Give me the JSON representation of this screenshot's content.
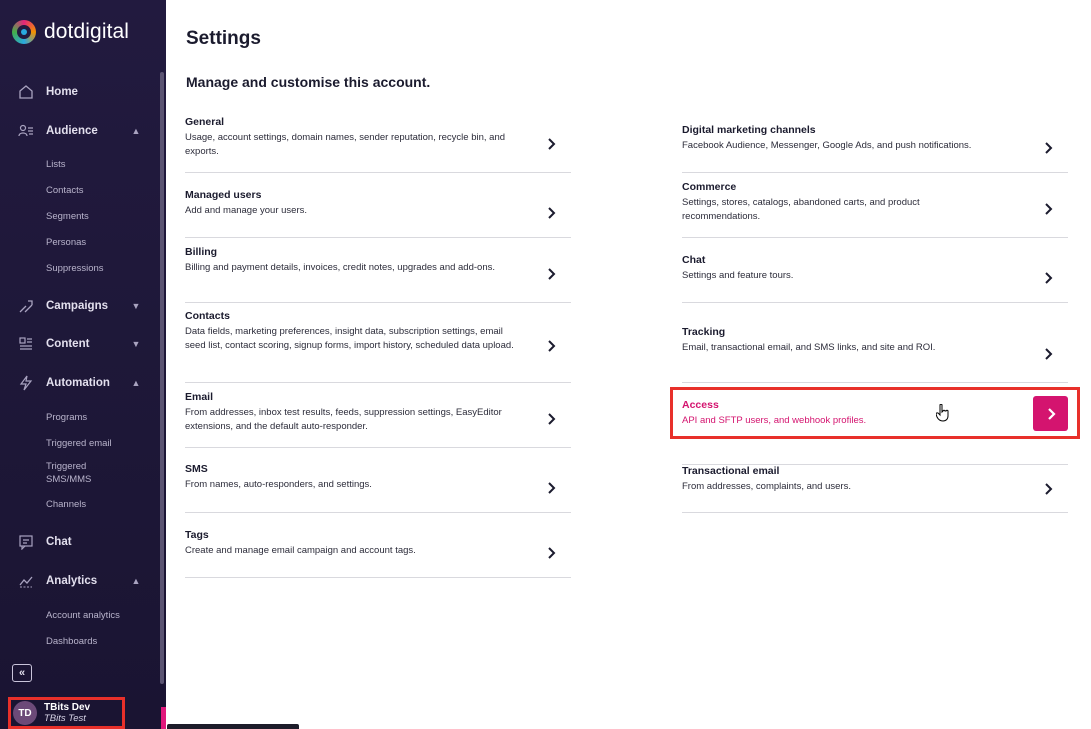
{
  "brand": {
    "name": "dotdigital"
  },
  "sidebar": {
    "nav": [
      {
        "label": "Home",
        "icon": "home-icon"
      },
      {
        "label": "Audience",
        "icon": "audience-icon",
        "expanded": true,
        "children": [
          "Lists",
          "Contacts",
          "Segments",
          "Personas",
          "Suppressions"
        ]
      },
      {
        "label": "Campaigns",
        "icon": "campaigns-icon",
        "expanded": false
      },
      {
        "label": "Content",
        "icon": "content-icon",
        "expanded": false
      },
      {
        "label": "Automation",
        "icon": "automation-icon",
        "expanded": true,
        "children": [
          "Programs",
          "Triggered email",
          "Triggered SMS/MMS",
          "Channels"
        ]
      },
      {
        "label": "Chat",
        "icon": "chat-icon"
      },
      {
        "label": "Analytics",
        "icon": "analytics-icon",
        "expanded": true,
        "children": [
          "Account analytics",
          "Dashboards"
        ]
      }
    ],
    "collapse_icon": "double-chevron-left-icon",
    "user": {
      "initials": "TD",
      "name": "TBits Dev",
      "account": "TBits Test"
    }
  },
  "main": {
    "title": "Settings",
    "subtitle": "Manage and customise this account.",
    "left_cards": [
      {
        "title": "General",
        "desc": "Usage, account settings, domain names, sender reputation, recycle bin, and exports."
      },
      {
        "title": "Managed users",
        "desc": "Add and manage your users."
      },
      {
        "title": "Billing",
        "desc": "Billing and payment details, invoices, credit notes, upgrades and add-ons."
      },
      {
        "title": "Contacts",
        "desc": "Data fields, marketing preferences, insight data, subscription settings, email seed list, contact scoring, signup forms, import history, scheduled data upload."
      },
      {
        "title": "Email",
        "desc": "From addresses, inbox test results, feeds, suppression settings, EasyEditor extensions, and the default auto-responder."
      },
      {
        "title": "SMS",
        "desc": "From names, auto-responders, and settings."
      },
      {
        "title": "Tags",
        "desc": "Create and manage email campaign and account tags."
      }
    ],
    "right_cards": [
      {
        "title": "Digital marketing channels",
        "desc": "Facebook Audience, Messenger, Google Ads, and push notifications."
      },
      {
        "title": "Commerce",
        "desc": "Settings, stores, catalogs, abandoned carts, and product recommendations."
      },
      {
        "title": "Chat",
        "desc": "Settings and feature tours."
      },
      {
        "title": "Tracking",
        "desc": "Email, transactional email, and SMS links, and site and ROI."
      },
      {
        "title": "Access",
        "desc": "API and SFTP users, and webhook profiles.",
        "highlighted": true
      },
      {
        "title": "Transactional email",
        "desc": "From addresses, complaints, and users."
      }
    ]
  },
  "colors": {
    "sidebar_bg": "#221a3f",
    "accent": "#d4146f",
    "highlight_border": "#e8302a",
    "text": "#1b1b2e"
  }
}
